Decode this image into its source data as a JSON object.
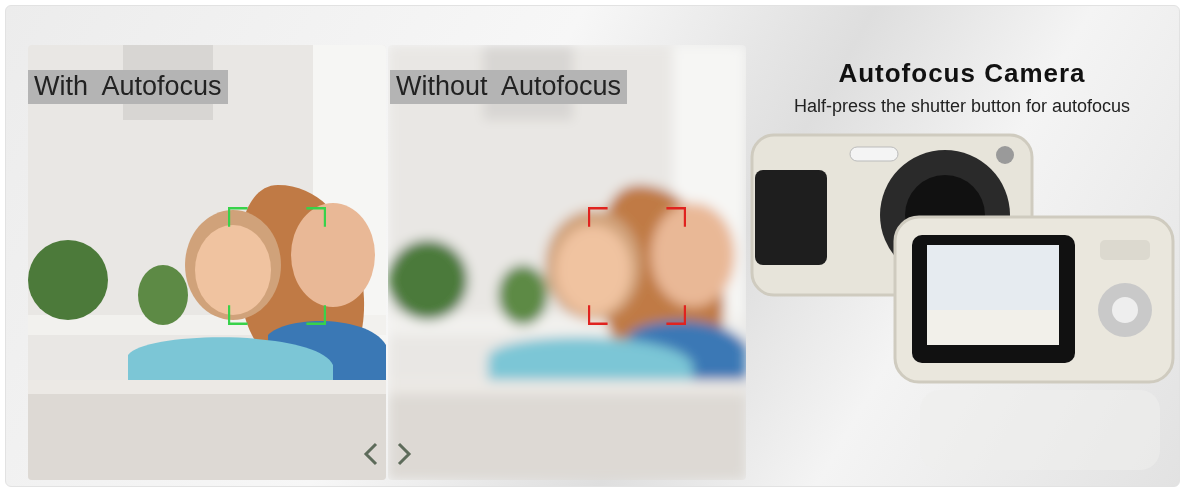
{
  "panels": [
    {
      "label": "With  Autofocus",
      "focused": true
    },
    {
      "label": "Without  Autofocus",
      "focused": false
    }
  ],
  "heading": {
    "title": "Autofocus Camera",
    "subtitle": "Half-press the shutter button for autofocus"
  }
}
